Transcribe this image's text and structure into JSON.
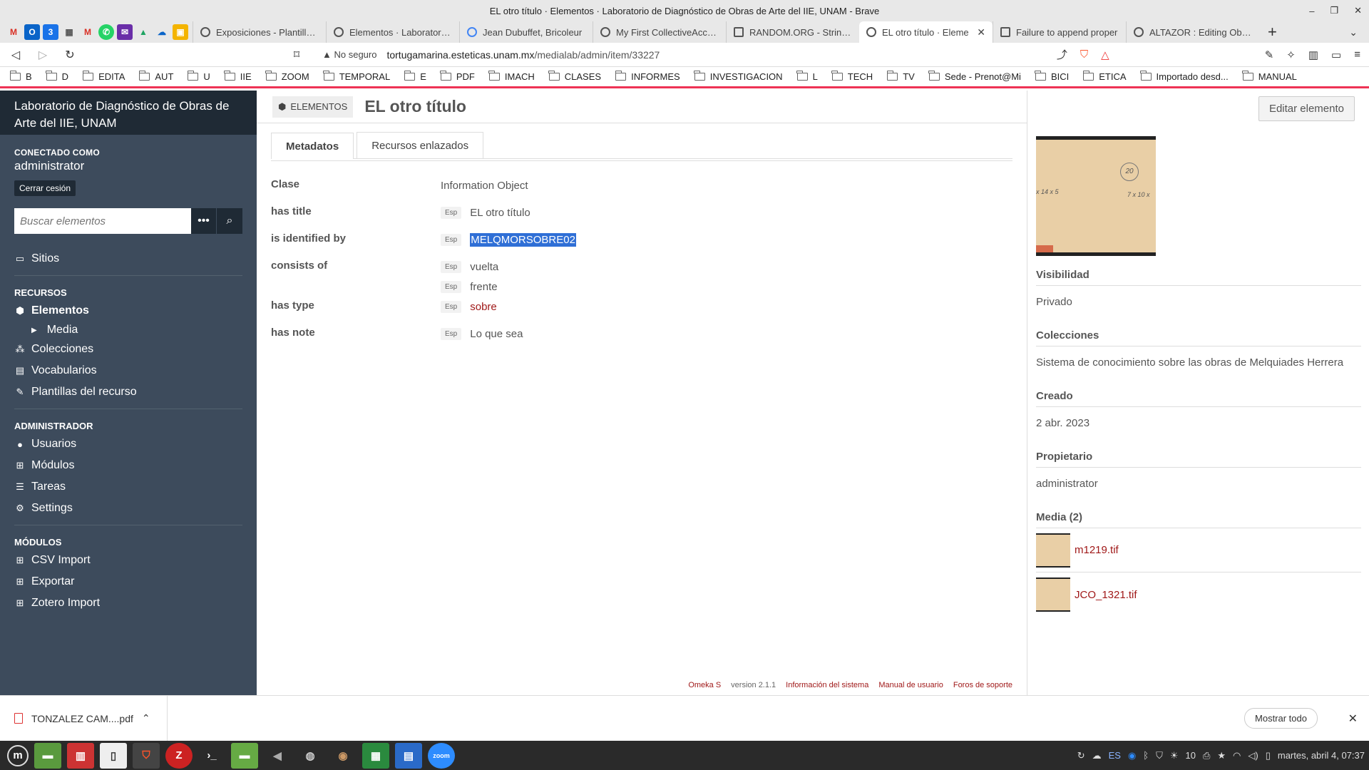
{
  "window": {
    "title": "EL otro título · Elementos · Laboratorio de Diagnóstico de Obras de Arte del IIE, UNAM - Brave",
    "controls": [
      "–",
      "❐",
      "✕"
    ]
  },
  "tabs": [
    {
      "label": "Exposiciones - Plantillas c",
      "active": false
    },
    {
      "label": "Elementos · Laboratorio c",
      "active": false
    },
    {
      "label": "Jean Dubuffet, Bricoleur",
      "active": false
    },
    {
      "label": "My First CollectiveAccess",
      "active": false
    },
    {
      "label": "RANDOM.ORG - String Ge",
      "active": false
    },
    {
      "label": "EL otro título · Eleme",
      "active": true
    },
    {
      "label": "Failure to append proper",
      "active": false
    },
    {
      "label": "ALTAZOR : Editing Obra d",
      "active": false
    }
  ],
  "address": {
    "security": "No seguro",
    "host": "tortugamarina.esteticas.unam.mx",
    "path": "/medialab/admin/item/33227"
  },
  "bookmarks": [
    "B",
    "D",
    "EDITA",
    "AUT",
    "U",
    "IIE",
    "ZOOM",
    "TEMPORAL",
    "E",
    "PDF",
    "IMACH",
    "CLASES",
    "INFORMES",
    "INVESTIGACION",
    "L",
    "TECH",
    "TV",
    "Sede - Prenot@Mi",
    "BICI",
    "ETICA",
    "Importado desd...",
    "MANUAL"
  ],
  "sidebar": {
    "site_title": "Laboratorio de Diagnóstico de Obras de Arte del IIE, UNAM",
    "logged_label": "Conectado como",
    "user": "administrator",
    "logout": "Cerrar cesión",
    "search_placeholder": "Buscar elementos",
    "sites": "Sitios",
    "recursos_head": "Recursos",
    "recursos": [
      "Elementos",
      "Colecciones",
      "Vocabularios",
      "Plantillas del recurso"
    ],
    "media": "Media",
    "admin_head": "Administrador",
    "admin": [
      "Usuarios",
      "Módulos",
      "Tareas",
      "Settings"
    ],
    "modulos_head": "Módulos",
    "modulos": [
      "CSV Import",
      "Exportar",
      "Zotero Import"
    ]
  },
  "main": {
    "crumb": "Elementos",
    "title": "EL otro título",
    "tab_meta": "Metadatos",
    "tab_links": "Recursos enlazados",
    "props": {
      "clase_label": "Clase",
      "clase_value": "Information Object",
      "title_label": "has title",
      "title_lang": "Esp",
      "title_value": "EL otro título",
      "ident_label": "is identified by",
      "ident_lang": "Esp",
      "ident_value": "MELQMORSOBRE02",
      "consists_label": "consists of",
      "consists_lang1": "Esp",
      "consists_value1": "vuelta",
      "consists_lang2": "Esp",
      "consists_value2": "frente",
      "type_label": "has type",
      "type_lang": "Esp",
      "type_value": "sobre",
      "note_label": "has note",
      "note_lang": "Esp",
      "note_value": "Lo que sea"
    },
    "footer": {
      "omeka": "Omeka S",
      "version": "version 2.1.1",
      "info": "Información del sistema",
      "manual": "Manual de usuario",
      "foros": "Foros de soporte"
    }
  },
  "side": {
    "edit": "Editar elemento",
    "thumb_marks": {
      "circle": "20",
      "mark_a": "7 x 10 x",
      "mark_b": "x 14 x 5"
    },
    "vis_label": "Visibilidad",
    "vis_value": "Privado",
    "col_label": "Colecciones",
    "col_value": "Sistema de conocimiento sobre las obras de Melquiades Herrera",
    "created_label": "Creado",
    "created_value": "2 abr. 2023",
    "owner_label": "Propietario",
    "owner_value": "administrator",
    "media_label": "Media (2)",
    "media": [
      "m1219.tif",
      "JCO_1321.tif"
    ]
  },
  "download": {
    "file": "TONZALEZ CAM....pdf",
    "show_all": "Mostrar todo"
  },
  "taskbar": {
    "lang": "ES",
    "volume": "10",
    "clock": "martes, abril 4, 07:37"
  }
}
